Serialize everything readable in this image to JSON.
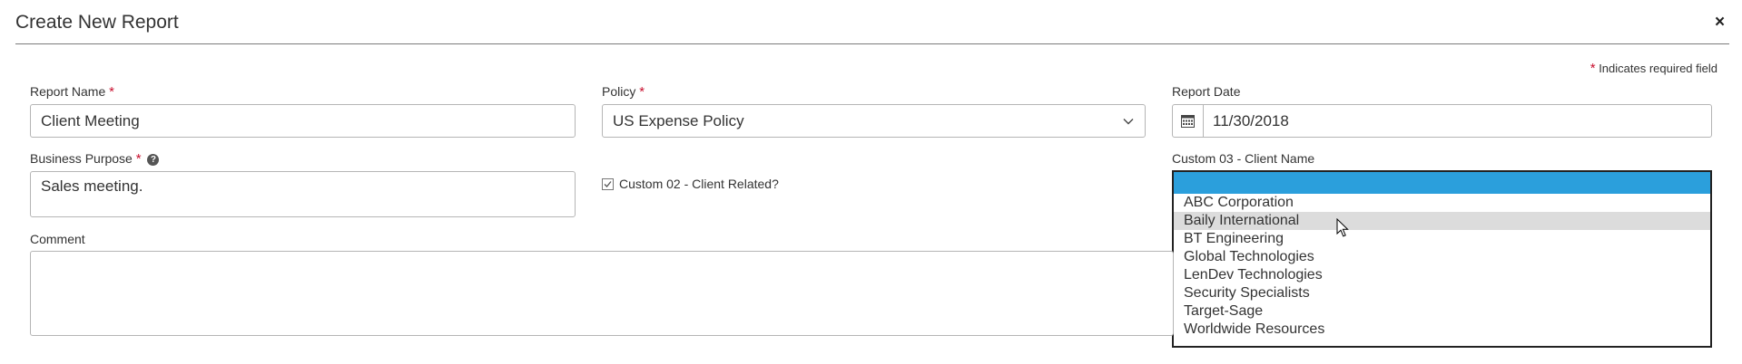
{
  "dialog": {
    "title": "Create New Report",
    "close_glyph": "×"
  },
  "required_note": {
    "star": "*",
    "text": "Indicates required field"
  },
  "fields": {
    "report_name": {
      "label": "Report Name",
      "star": "*",
      "value": "Client Meeting"
    },
    "policy": {
      "label": "Policy",
      "star": "*",
      "value": "US Expense Policy"
    },
    "report_date": {
      "label": "Report Date",
      "value": "11/30/2018"
    },
    "business_purpose": {
      "label": "Business Purpose",
      "star": "*",
      "help": "?",
      "value": "Sales meeting."
    },
    "custom02": {
      "label": "Custom 02 - Client Related?",
      "checked": true
    },
    "custom03": {
      "label": "Custom 03 - Client Name",
      "selected_index": 0,
      "hover_index": 2,
      "options": [
        "",
        "ABC Corporation",
        "Baily International",
        "BT Engineering",
        "Global Technologies",
        "LenDev Technologies",
        "Security Specialists",
        "Target-Sage",
        "Worldwide Resources"
      ]
    },
    "comment": {
      "label": "Comment",
      "value": ""
    }
  },
  "colors": {
    "accent_selected": "#2b9fdc",
    "hover": "#dcdcdc",
    "required": "#c8102e"
  },
  "icons": {
    "close": "close-icon",
    "calendar": "calendar-icon",
    "dropdown": "chevron-down-icon",
    "help": "help-icon",
    "checkbox": "checkbox-icon",
    "cursor": "mouse-cursor-icon"
  }
}
